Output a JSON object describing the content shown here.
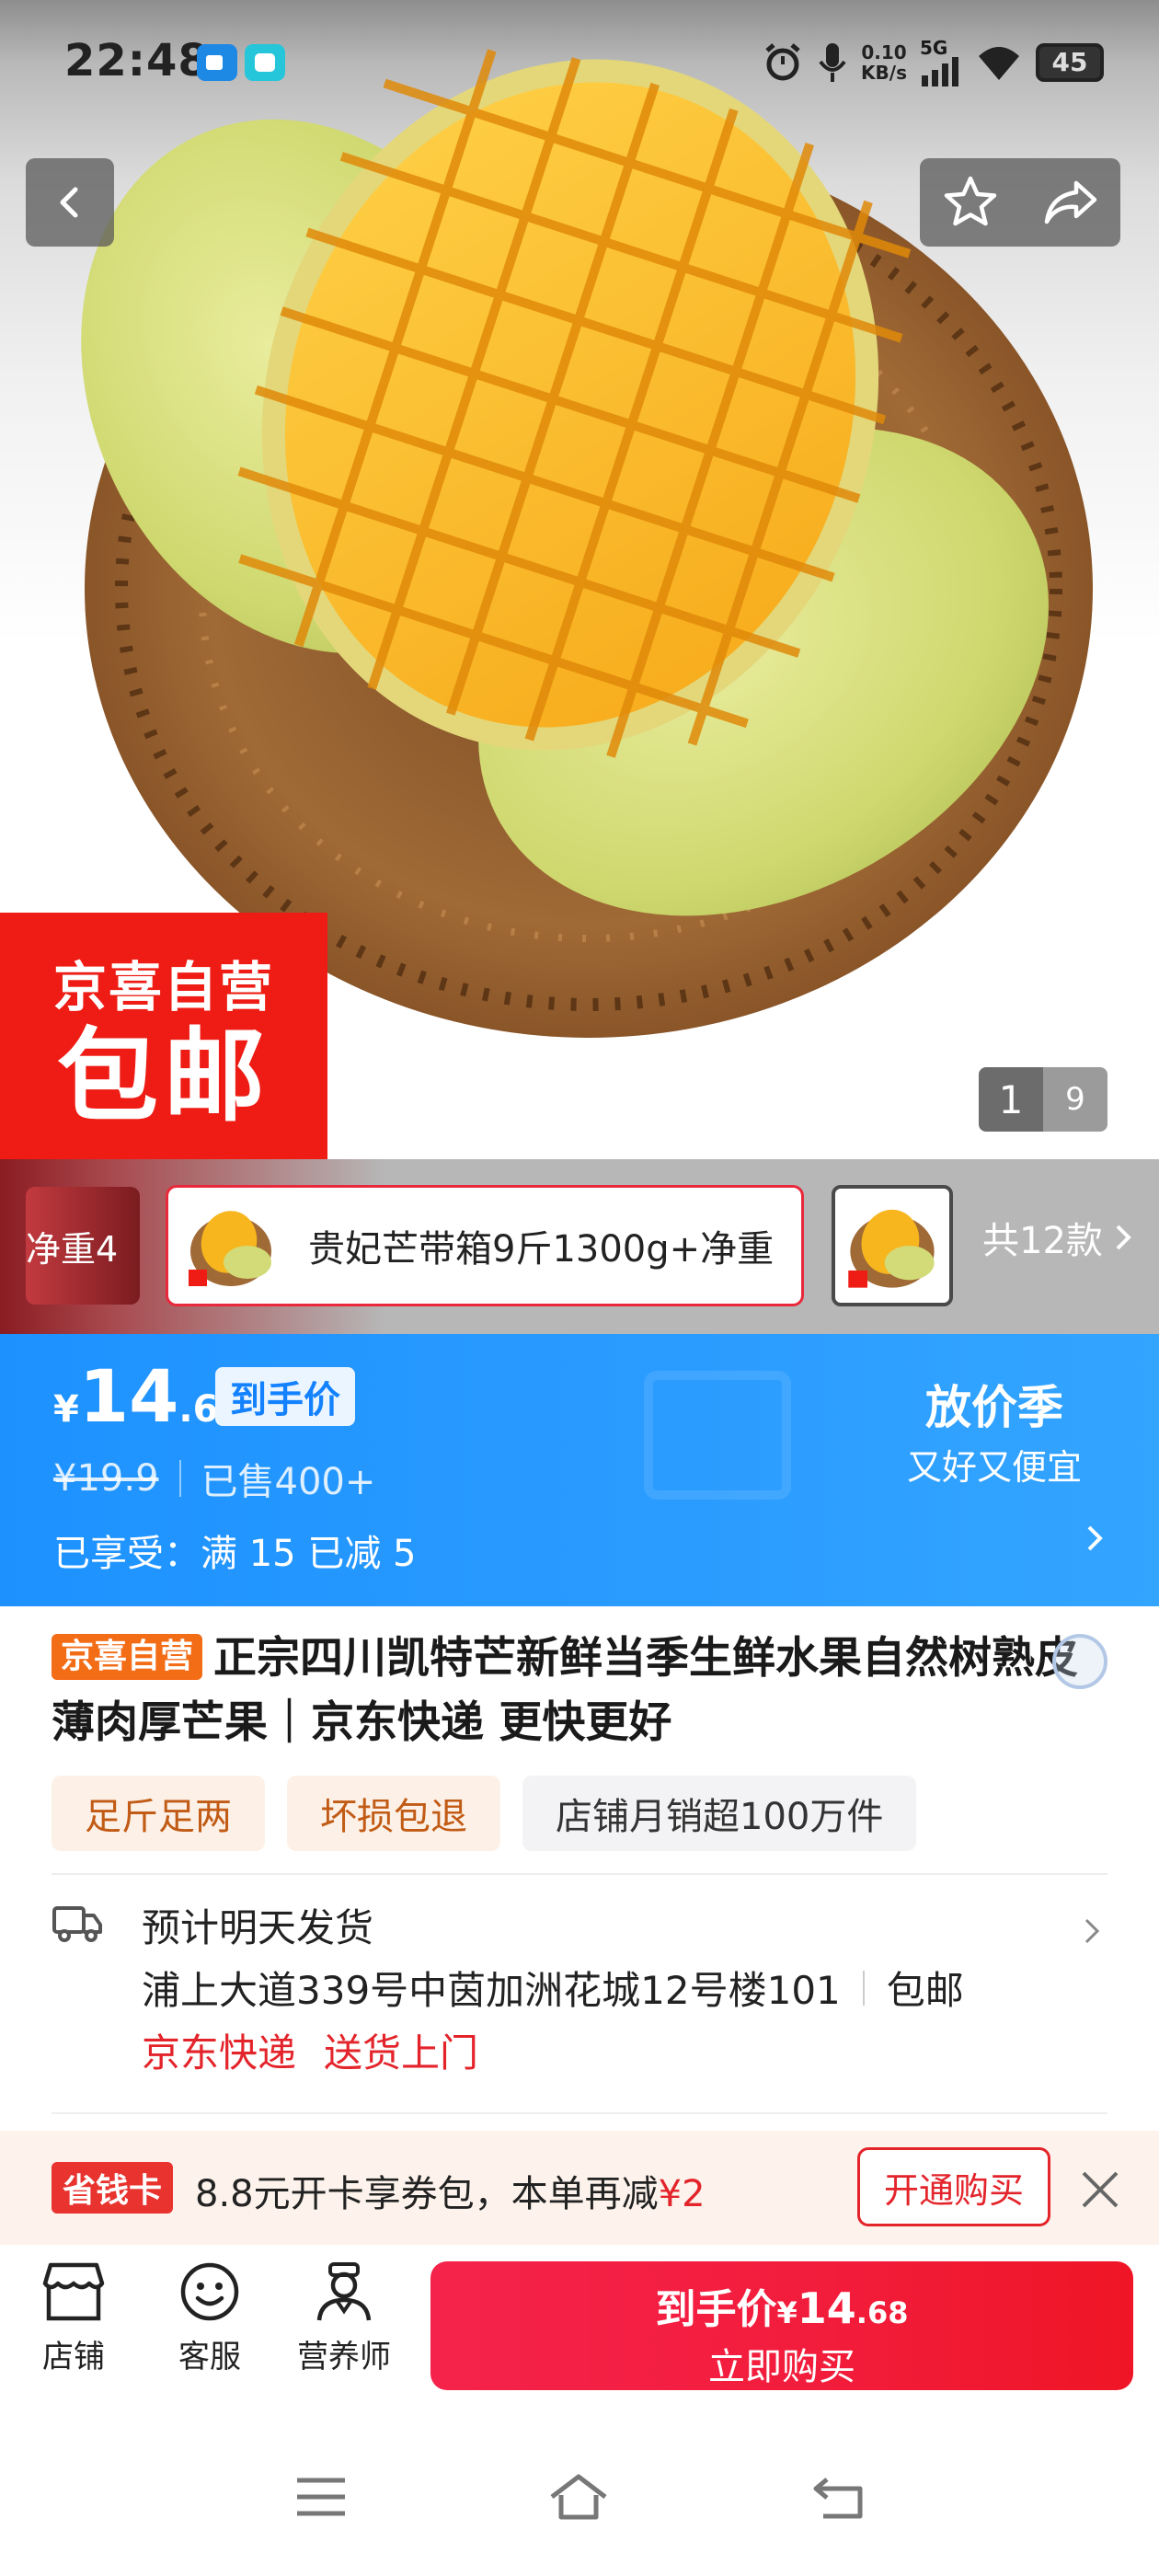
{
  "status_bar": {
    "time": "22:48",
    "net_speed_value": "0.10",
    "net_speed_unit": "KB/s",
    "network": "5G",
    "battery": "45"
  },
  "gallery": {
    "current_page": "1",
    "total_pages": "9",
    "promo_line1": "京喜自营",
    "promo_line2": "包邮"
  },
  "variants": {
    "prev_label": "净重4",
    "active_label": "贵妃芒带箱9斤1300g+净重",
    "all_label": "共12款"
  },
  "price": {
    "yen": "¥",
    "integer": "14",
    "decimal": ".68",
    "tag": "到手价",
    "original": "¥19.9",
    "sold": "已售400+",
    "enjoy": "已享受：满 15 已减 5",
    "season_title": "放价季",
    "season_sub": "又好又便宜"
  },
  "product": {
    "self_tag": "京喜自营",
    "title": "正宗四川凯特芒新鲜当季生鲜水果自然树熟皮薄肉厚芒果｜京东快递 更快更好",
    "chips": [
      "足斤足两",
      "坏损包退",
      "店铺月销超100万件"
    ]
  },
  "shipping": {
    "eta": "预计明天发货",
    "address": "浦上大道339号中茵加洲花城12号楼101",
    "free_shipping": "包邮",
    "carrier": "京东快递",
    "service": "送货上门"
  },
  "savings_card": {
    "tag": "省钱卡",
    "text": "8.8元开卡享券包，本单再减",
    "amount": "¥2",
    "button": "开通购买"
  },
  "action_bar": {
    "shop": "店铺",
    "service": "客服",
    "nutritionist": "营养师",
    "buy_line1_prefix": "到手价",
    "buy_yen": "¥",
    "buy_int": "14",
    "buy_dec": ".68",
    "buy_line2": "立即购买"
  },
  "colors": {
    "brand_red": "#ee1c14",
    "price_blue": "#1d92ff",
    "buy_red": "#f21c3a",
    "orange_tag": "#f36c16"
  },
  "icons": [
    "back-icon",
    "star-icon",
    "share-icon",
    "truck-icon",
    "chevron-right-icon",
    "close-icon",
    "shop-icon",
    "service-icon",
    "nutritionist-icon",
    "menu-icon",
    "home-icon",
    "return-icon"
  ]
}
